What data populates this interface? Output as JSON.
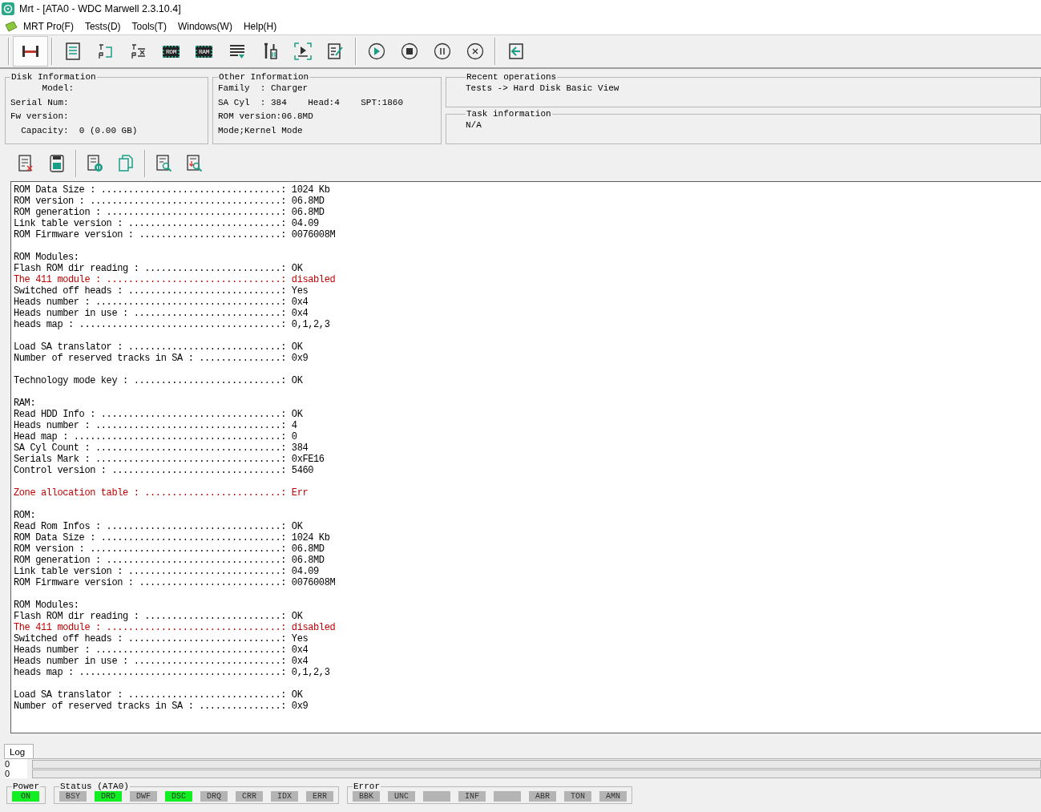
{
  "window": {
    "title": "Mrt - [ATA0 - WDC Marwell 2.3.10.4]"
  },
  "menu": [
    "MRT Pro(F)",
    "Tests(D)",
    "Tools(T)",
    "Windows(W)",
    "Help(H)"
  ],
  "toolbar": [
    {
      "kind": "connect",
      "selected": true
    },
    {
      "kind": "disk",
      "selected": false
    },
    {
      "kind": "tr",
      "selected": false
    },
    {
      "kind": "trx",
      "selected": false
    },
    {
      "kind": "chip",
      "label": "ROM",
      "selected": false
    },
    {
      "kind": "chip",
      "label": "RAM",
      "selected": false
    },
    {
      "kind": "list",
      "selected": false
    },
    {
      "kind": "tools",
      "selected": false
    },
    {
      "kind": "media",
      "selected": false
    },
    {
      "kind": "edit",
      "selected": false
    },
    {
      "kind": "play",
      "selected": false
    },
    {
      "kind": "stop",
      "selected": false
    },
    {
      "kind": "pause",
      "selected": false
    },
    {
      "kind": "cancel",
      "selected": false
    },
    {
      "kind": "exit",
      "selected": false
    }
  ],
  "disk_information": {
    "title": "Disk Information",
    "lines": [
      "      Model:",
      "Serial Num:",
      "Fw version:",
      "  Capacity:  0 (0.00 GB)"
    ]
  },
  "other_information": {
    "title": "Other Information",
    "lines": [
      "Family  : Charger",
      "SA Cyl  : 384    Head:4    SPT:1860",
      "ROM version:06.8MD",
      "Mode;Kernel Mode"
    ]
  },
  "recent_operations": {
    "title": "Recent operations",
    "text": "Tests -> Hard Disk Basic View"
  },
  "task_information": {
    "title": "Task information",
    "text": "N/A"
  },
  "log_groups": [
    [
      {
        "text": "ROM Data Size : .................................: 1024 Kb",
        "error": false
      },
      {
        "text": "ROM version : ...................................: 06.8MD",
        "error": false
      },
      {
        "text": "ROM generation : ................................: 06.8MD",
        "error": false
      },
      {
        "text": "Link table version : ............................: 04.09",
        "error": false
      },
      {
        "text": "ROM Firmware version : ..........................: 0076008M",
        "error": false
      }
    ],
    [
      {
        "text": "ROM Modules:",
        "error": false
      },
      {
        "text": "Flash ROM dir reading : .........................: OK",
        "error": false
      },
      {
        "text": "The 411 module : ................................: disabled",
        "error": true
      },
      {
        "text": "Switched off heads : ............................: Yes",
        "error": false
      },
      {
        "text": "Heads number : ..................................: 0x4",
        "error": false
      },
      {
        "text": "Heads number in use : ...........................: 0x4",
        "error": false
      },
      {
        "text": "heads map : .....................................: 0,1,2,3",
        "error": false
      }
    ],
    [
      {
        "text": "Load SA translator : ............................: OK",
        "error": false
      },
      {
        "text": "Number of reserved tracks in SA : ...............: 0x9",
        "error": false
      }
    ],
    [
      {
        "text": "Technology mode key : ...........................: OK",
        "error": false
      }
    ],
    [
      {
        "text": "RAM:",
        "error": false
      },
      {
        "text": "Read HDD Info : .................................: OK",
        "error": false
      },
      {
        "text": "Heads number : ..................................: 4",
        "error": false
      },
      {
        "text": "Head map : ......................................: 0",
        "error": false
      },
      {
        "text": "SA Cyl Count : ..................................: 384",
        "error": false
      },
      {
        "text": "Serials Mark : ..................................: 0xFE16",
        "error": false
      },
      {
        "text": "Control version : ...............................: 5460",
        "error": false
      }
    ],
    [
      {
        "text": "Zone allocation table : .........................: Err",
        "error": true
      }
    ],
    [
      {
        "text": "ROM:",
        "error": false
      },
      {
        "text": "Read Rom Infos : ................................: OK",
        "error": false
      },
      {
        "text": "ROM Data Size : .................................: 1024 Kb",
        "error": false
      },
      {
        "text": "ROM version : ...................................: 06.8MD",
        "error": false
      },
      {
        "text": "ROM generation : ................................: 06.8MD",
        "error": false
      },
      {
        "text": "Link table version : ............................: 04.09",
        "error": false
      },
      {
        "text": "ROM Firmware version : ..........................: 0076008M",
        "error": false
      }
    ],
    [
      {
        "text": "ROM Modules:",
        "error": false
      },
      {
        "text": "Flash ROM dir reading : .........................: OK",
        "error": false
      },
      {
        "text": "The 411 module : ................................: disabled",
        "error": true
      },
      {
        "text": "Switched off heads : ............................: Yes",
        "error": false
      },
      {
        "text": "Heads number : ..................................: 0x4",
        "error": false
      },
      {
        "text": "Heads number in use : ...........................: 0x4",
        "error": false
      },
      {
        "text": "heads map : .....................................: 0,1,2,3",
        "error": false
      }
    ],
    [
      {
        "text": "Load SA translator : ............................: OK",
        "error": false
      },
      {
        "text": "Number of reserved tracks in SA : ...............: 0x9",
        "error": false
      }
    ]
  ],
  "tabs": [
    {
      "label": "Log",
      "selected": true
    }
  ],
  "progress": [
    {
      "reading": "0"
    },
    {
      "reading": "0"
    }
  ],
  "power": {
    "title": "Power",
    "indicators": [
      {
        "label": "ON",
        "on": true
      }
    ]
  },
  "status": {
    "title": "Status (ATA0)",
    "indicators": [
      {
        "label": "BSY",
        "on": false
      },
      {
        "label": "DRD",
        "on": true
      },
      {
        "label": "DWF",
        "on": false
      },
      {
        "label": "DSC",
        "on": true
      },
      {
        "label": "DRQ",
        "on": false
      },
      {
        "label": "CRR",
        "on": false
      },
      {
        "label": "IDX",
        "on": false
      },
      {
        "label": "ERR",
        "on": false
      }
    ]
  },
  "error": {
    "title": "Error",
    "indicators": [
      {
        "label": "BBK",
        "on": false
      },
      {
        "label": "UNC",
        "on": false
      },
      {
        "on": false
      },
      {
        "label": "INF",
        "on": false
      },
      {
        "on": false
      },
      {
        "label": "ABR",
        "on": false
      },
      {
        "label": "TON",
        "on": false
      },
      {
        "label": "AMN",
        "on": false
      }
    ]
  }
}
